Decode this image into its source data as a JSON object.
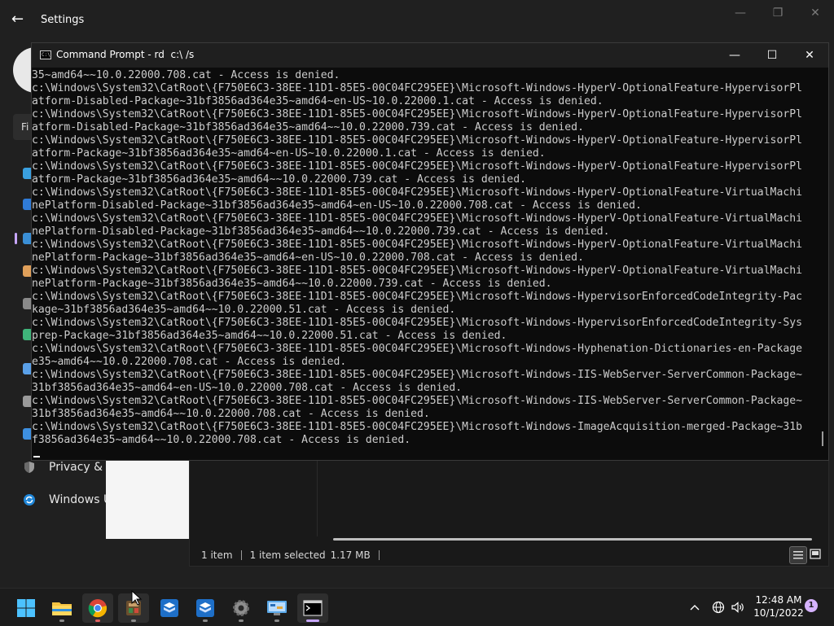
{
  "settings": {
    "title": "Settings",
    "find_placeholder": "Fi",
    "nav": [
      {
        "label": "Privacy & s",
        "icon": "shield-icon"
      },
      {
        "label": "Windows U",
        "icon": "windows-update-icon"
      }
    ]
  },
  "explorer": {
    "status_items": "1 item",
    "status_selected": "1 item selected",
    "status_size": "1.17 MB"
  },
  "cmd": {
    "title": "Command Prompt - rd  c:\\ /s",
    "icon_text": "C:\\",
    "lines": [
      "35~amd64~~10.0.22000.708.cat - Access is denied.",
      "c:\\Windows\\System32\\CatRoot\\{F750E6C3-38EE-11D1-85E5-00C04FC295EE}\\Microsoft-Windows-HyperV-OptionalFeature-HypervisorPl",
      "atform-Disabled-Package~31bf3856ad364e35~amd64~en-US~10.0.22000.1.cat - Access is denied.",
      "c:\\Windows\\System32\\CatRoot\\{F750E6C3-38EE-11D1-85E5-00C04FC295EE}\\Microsoft-Windows-HyperV-OptionalFeature-HypervisorPl",
      "atform-Disabled-Package~31bf3856ad364e35~amd64~~10.0.22000.739.cat - Access is denied.",
      "c:\\Windows\\System32\\CatRoot\\{F750E6C3-38EE-11D1-85E5-00C04FC295EE}\\Microsoft-Windows-HyperV-OptionalFeature-HypervisorPl",
      "atform-Package~31bf3856ad364e35~amd64~en-US~10.0.22000.1.cat - Access is denied.",
      "c:\\Windows\\System32\\CatRoot\\{F750E6C3-38EE-11D1-85E5-00C04FC295EE}\\Microsoft-Windows-HyperV-OptionalFeature-HypervisorPl",
      "atform-Package~31bf3856ad364e35~amd64~~10.0.22000.739.cat - Access is denied.",
      "c:\\Windows\\System32\\CatRoot\\{F750E6C3-38EE-11D1-85E5-00C04FC295EE}\\Microsoft-Windows-HyperV-OptionalFeature-VirtualMachi",
      "nePlatform-Disabled-Package~31bf3856ad364e35~amd64~en-US~10.0.22000.708.cat - Access is denied.",
      "c:\\Windows\\System32\\CatRoot\\{F750E6C3-38EE-11D1-85E5-00C04FC295EE}\\Microsoft-Windows-HyperV-OptionalFeature-VirtualMachi",
      "nePlatform-Disabled-Package~31bf3856ad364e35~amd64~~10.0.22000.739.cat - Access is denied.",
      "c:\\Windows\\System32\\CatRoot\\{F750E6C3-38EE-11D1-85E5-00C04FC295EE}\\Microsoft-Windows-HyperV-OptionalFeature-VirtualMachi",
      "nePlatform-Package~31bf3856ad364e35~amd64~en-US~10.0.22000.708.cat - Access is denied.",
      "c:\\Windows\\System32\\CatRoot\\{F750E6C3-38EE-11D1-85E5-00C04FC295EE}\\Microsoft-Windows-HyperV-OptionalFeature-VirtualMachi",
      "nePlatform-Package~31bf3856ad364e35~amd64~~10.0.22000.739.cat - Access is denied.",
      "c:\\Windows\\System32\\CatRoot\\{F750E6C3-38EE-11D1-85E5-00C04FC295EE}\\Microsoft-Windows-HypervisorEnforcedCodeIntegrity-Pac",
      "kage~31bf3856ad364e35~amd64~~10.0.22000.51.cat - Access is denied.",
      "c:\\Windows\\System32\\CatRoot\\{F750E6C3-38EE-11D1-85E5-00C04FC295EE}\\Microsoft-Windows-HypervisorEnforcedCodeIntegrity-Sys",
      "prep-Package~31bf3856ad364e35~amd64~~10.0.22000.51.cat - Access is denied.",
      "c:\\Windows\\System32\\CatRoot\\{F750E6C3-38EE-11D1-85E5-00C04FC295EE}\\Microsoft-Windows-Hyphenation-Dictionaries-en-Package",
      "e35~amd64~~10.0.22000.708.cat - Access is denied.",
      "c:\\Windows\\System32\\CatRoot\\{F750E6C3-38EE-11D1-85E5-00C04FC295EE}\\Microsoft-Windows-IIS-WebServer-ServerCommon-Package~",
      "31bf3856ad364e35~amd64~en-US~10.0.22000.708.cat - Access is denied.",
      "c:\\Windows\\System32\\CatRoot\\{F750E6C3-38EE-11D1-85E5-00C04FC295EE}\\Microsoft-Windows-IIS-WebServer-ServerCommon-Package~",
      "31bf3856ad364e35~amd64~~10.0.22000.708.cat - Access is denied.",
      "c:\\Windows\\System32\\CatRoot\\{F750E6C3-38EE-11D1-85E5-00C04FC295EE}\\Microsoft-Windows-ImageAcquisition-merged-Package~31b",
      "f3856ad364e35~amd64~~10.0.22000.708.cat - Access is denied."
    ]
  },
  "taskbar": {
    "apps": [
      "windows-start-icon",
      "file-explorer-icon",
      "chrome-icon",
      "app-icon",
      "virtualbox-icon",
      "virtualbox-icon-2",
      "settings-gear-icon",
      "control-panel-icon",
      "terminal-icon"
    ],
    "time": "12:48 AM",
    "date": "10/1/2022",
    "notification_count": "1"
  },
  "colors": {
    "accent": "#c7a6ff",
    "console_bg": "#0c0c0c",
    "console_text": "#cccccc"
  }
}
